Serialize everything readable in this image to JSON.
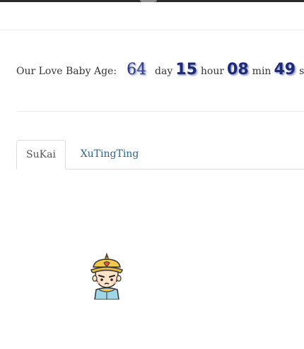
{
  "counter": {
    "label": "Our Love Baby Age:",
    "days": "64",
    "day_unit": "day",
    "hours": "15",
    "hour_unit": "hour",
    "minutes": "08",
    "min_unit": "min",
    "seconds": "49",
    "sec_unit": "sec"
  },
  "tabs": [
    {
      "label": "SuKai",
      "active": true
    },
    {
      "label": "XuTingTing",
      "active": false
    }
  ],
  "avatar": {
    "icon": "emperor-cartoon-icon"
  },
  "colors": {
    "digit": "#1e2a78",
    "link": "#2a6496",
    "border": "#dddddd"
  }
}
